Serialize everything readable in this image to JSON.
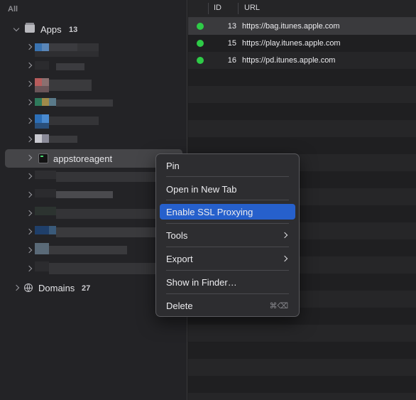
{
  "sidebar": {
    "all_label": "All",
    "apps": {
      "label": "Apps",
      "count": "13"
    },
    "selected_app": "appstoreagent",
    "domains": {
      "label": "Domains",
      "count": "27"
    }
  },
  "table": {
    "headers": {
      "id": "ID",
      "url": "URL"
    },
    "rows": [
      {
        "status": "ok",
        "id": "13",
        "url": "https://bag.itunes.apple.com"
      },
      {
        "status": "ok",
        "id": "15",
        "url": "https://play.itunes.apple.com"
      },
      {
        "status": "ok",
        "id": "16",
        "url": "https://pd.itunes.apple.com"
      }
    ]
  },
  "context_menu": {
    "items": [
      {
        "label": "Pin"
      },
      {
        "label": "Open in New Tab"
      },
      {
        "label": "Enable SSL Proxying",
        "highlighted": true
      },
      {
        "label": "Tools",
        "submenu": true
      },
      {
        "label": "Export",
        "submenu": true
      },
      {
        "label": "Show in Finder…"
      },
      {
        "label": "Delete",
        "shortcut": "⌘⌫"
      }
    ]
  },
  "colors": {
    "status_ok": "#2ecb47",
    "menu_highlight": "#2660cc",
    "selection": "#454548"
  }
}
